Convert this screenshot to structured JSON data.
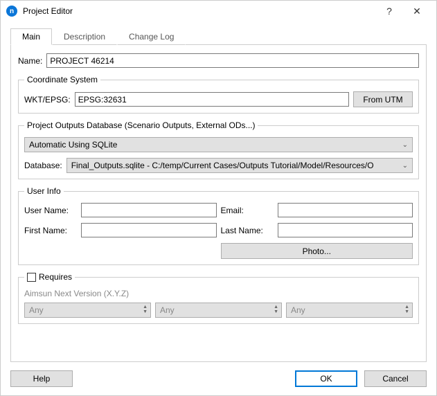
{
  "window": {
    "title": "Project Editor",
    "help": "?",
    "close": "✕"
  },
  "tabs": {
    "main": "Main",
    "description": "Description",
    "changelog": "Change Log"
  },
  "name_label": "Name:",
  "name_value": "PROJECT 46214",
  "coord": {
    "legend": "Coordinate System",
    "label": "WKT/EPSG:",
    "value": "EPSG:32631",
    "from_utm": "From UTM"
  },
  "outputs": {
    "legend": "Project Outputs Database (Scenario Outputs, External ODs...)",
    "mode": "Automatic Using SQLite",
    "db_label": "Database:",
    "db_value": "Final_Outputs.sqlite - C:/temp/Current Cases/Outputs Tutorial/Model/Resources/O"
  },
  "userinfo": {
    "legend": "User Info",
    "user_name": "User Name:",
    "email": "Email:",
    "first_name": "First Name:",
    "last_name": "Last Name:",
    "photo": "Photo..."
  },
  "requires": {
    "legend": "Requires",
    "version_label": "Aimsun Next Version (X.Y.Z)",
    "any": "Any"
  },
  "footer": {
    "help": "Help",
    "ok": "OK",
    "cancel": "Cancel"
  }
}
